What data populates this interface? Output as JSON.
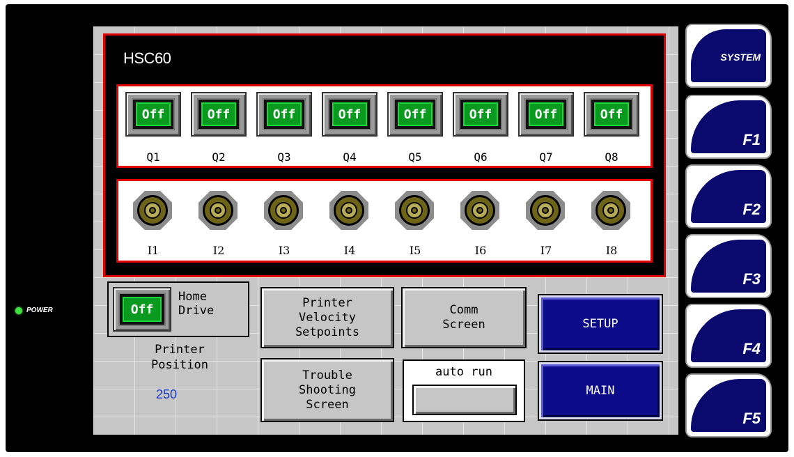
{
  "power_label": "POWER",
  "panel_title": "HSC60",
  "outputs": [
    {
      "label": "Q1",
      "state": "Off"
    },
    {
      "label": "Q2",
      "state": "Off"
    },
    {
      "label": "Q3",
      "state": "Off"
    },
    {
      "label": "Q4",
      "state": "Off"
    },
    {
      "label": "Q5",
      "state": "Off"
    },
    {
      "label": "Q6",
      "state": "Off"
    },
    {
      "label": "Q7",
      "state": "Off"
    },
    {
      "label": "Q8",
      "state": "Off"
    }
  ],
  "inputs": [
    {
      "label": "I1"
    },
    {
      "label": "I2"
    },
    {
      "label": "I3"
    },
    {
      "label": "I4"
    },
    {
      "label": "I5"
    },
    {
      "label": "I6"
    },
    {
      "label": "I7"
    },
    {
      "label": "I8"
    }
  ],
  "home_drive": {
    "state": "Off",
    "label": "Home\nDrive"
  },
  "printer_position": {
    "label": "Printer\nPosition",
    "value": "250"
  },
  "buttons": {
    "printer_velocity": "Printer\nVelocity\nSetpoints",
    "comm_screen": "Comm\nScreen",
    "trouble_shooting": "Trouble\nShooting\nScreen",
    "auto_run": "auto run",
    "setup": "SETUP",
    "main": "MAIN"
  },
  "function_keys": [
    "SYSTEM",
    "F1",
    "F2",
    "F3",
    "F4",
    "F5"
  ],
  "colors": {
    "frame_border": "#e00000",
    "lamp_green": "#0a9a20",
    "nav_blue": "#0c0c8a",
    "value_blue": "#1638c8"
  }
}
